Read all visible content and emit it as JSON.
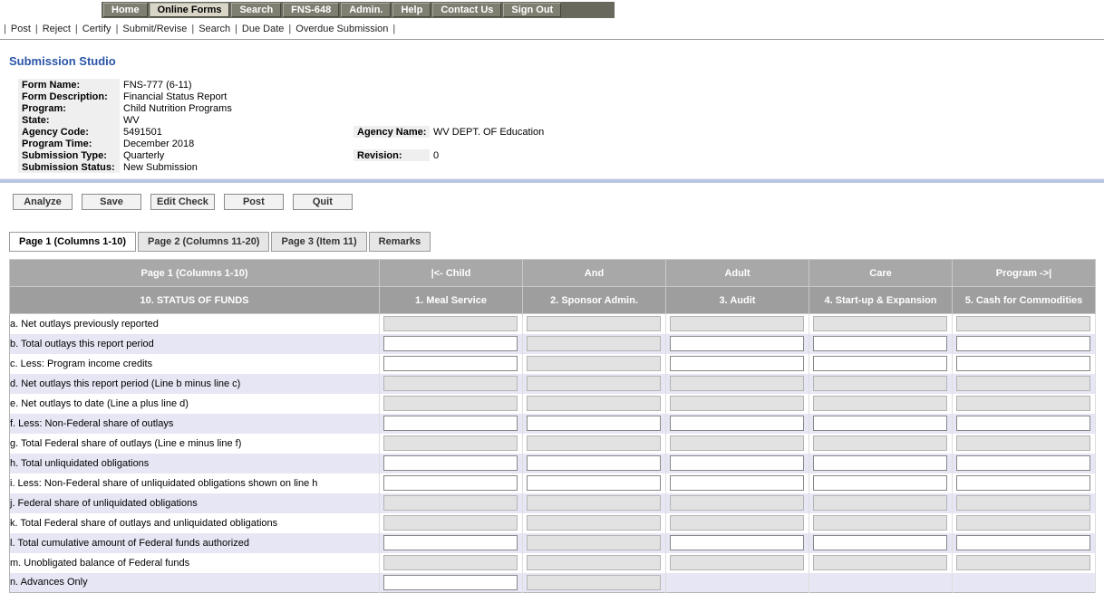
{
  "nav": {
    "items": [
      {
        "label": "Home",
        "active": false
      },
      {
        "label": "Online Forms",
        "active": true
      },
      {
        "label": "Search",
        "active": false
      },
      {
        "label": "FNS-648",
        "active": false
      },
      {
        "label": "Admin.",
        "active": false
      },
      {
        "label": "Help",
        "active": false
      },
      {
        "label": "Contact Us",
        "active": false
      },
      {
        "label": "Sign Out",
        "active": false
      }
    ]
  },
  "menu": {
    "items": [
      "Post",
      "Reject",
      "Certify",
      "Submit/Revise",
      "Search",
      "Due Date",
      "Overdue Submission"
    ]
  },
  "page_title": "Submission Studio",
  "info": {
    "rows": [
      {
        "label": "Form Name:",
        "value": "FNS-777 (6-11)"
      },
      {
        "label": "Form Description:",
        "value": "Financial Status Report"
      },
      {
        "label": "Program:",
        "value": "Child Nutrition Programs"
      },
      {
        "label": "State:",
        "value": "WV"
      },
      {
        "label": "Agency Code:",
        "value": "5491501",
        "label2": "Agency Name:",
        "value2": "WV DEPT. OF Education"
      },
      {
        "label": "Program Time:",
        "value": "December 2018"
      },
      {
        "label": "Submission Type:",
        "value": "Quarterly",
        "label2": "Revision:",
        "value2": "0"
      },
      {
        "label": "Submission Status:",
        "value": "New Submission"
      }
    ]
  },
  "actions": [
    "Analyze",
    "Save",
    "Edit Check",
    "Post",
    "Quit"
  ],
  "tabs": [
    {
      "label": "Page 1 (Columns 1-10)",
      "active": true
    },
    {
      "label": "Page 2 (Columns 11-20)",
      "active": false
    },
    {
      "label": "Page 3 (Item 11)",
      "active": false
    },
    {
      "label": "Remarks",
      "active": false
    }
  ],
  "grid": {
    "header_row1": [
      "Page 1 (Columns 1-10)",
      "|<- Child",
      "And",
      "Adult",
      "Care",
      "Program ->|"
    ],
    "header_row2": [
      "10. STATUS OF FUNDS",
      "1. Meal Service",
      "2. Sponsor Admin.",
      "3. Audit",
      "4. Start-up & Expansion",
      "5. Cash for Commodities"
    ],
    "rows": [
      {
        "label": "a. Net outlays previously reported",
        "cells": [
          {
            "type": "readonly",
            "value": ""
          },
          {
            "type": "readonly",
            "value": ""
          },
          {
            "type": "readonly",
            "value": ""
          },
          {
            "type": "readonly",
            "value": ""
          },
          {
            "type": "readonly",
            "value": ""
          }
        ]
      },
      {
        "label": "b. Total outlays this report period",
        "cells": [
          {
            "type": "input",
            "value": ""
          },
          {
            "type": "readonly",
            "value": ""
          },
          {
            "type": "input",
            "value": ""
          },
          {
            "type": "input",
            "value": ""
          },
          {
            "type": "input",
            "value": ""
          }
        ]
      },
      {
        "label": "c. Less: Program income credits",
        "cells": [
          {
            "type": "input",
            "value": ""
          },
          {
            "type": "readonly",
            "value": ""
          },
          {
            "type": "input",
            "value": ""
          },
          {
            "type": "input",
            "value": ""
          },
          {
            "type": "input",
            "value": ""
          }
        ]
      },
      {
        "label": "d. Net outlays this report period (Line b minus line c)",
        "cells": [
          {
            "type": "readonly",
            "value": ""
          },
          {
            "type": "readonly",
            "value": ""
          },
          {
            "type": "readonly",
            "value": ""
          },
          {
            "type": "readonly",
            "value": ""
          },
          {
            "type": "readonly",
            "value": ""
          }
        ]
      },
      {
        "label": "e. Net outlays to date (Line a plus line d)",
        "cells": [
          {
            "type": "readonly",
            "value": ""
          },
          {
            "type": "readonly",
            "value": ""
          },
          {
            "type": "readonly",
            "value": ""
          },
          {
            "type": "readonly",
            "value": ""
          },
          {
            "type": "readonly",
            "value": ""
          }
        ]
      },
      {
        "label": "f. Less: Non-Federal share of outlays",
        "cells": [
          {
            "type": "input",
            "value": ""
          },
          {
            "type": "input",
            "value": ""
          },
          {
            "type": "input",
            "value": ""
          },
          {
            "type": "input",
            "value": ""
          },
          {
            "type": "input",
            "value": ""
          }
        ]
      },
      {
        "label": "g. Total Federal share of outlays (Line e minus line f)",
        "cells": [
          {
            "type": "readonly",
            "value": ""
          },
          {
            "type": "readonly",
            "value": ""
          },
          {
            "type": "readonly",
            "value": ""
          },
          {
            "type": "readonly",
            "value": ""
          },
          {
            "type": "readonly",
            "value": ""
          }
        ]
      },
      {
        "label": "h. Total unliquidated obligations",
        "cells": [
          {
            "type": "input",
            "value": ""
          },
          {
            "type": "input",
            "value": ""
          },
          {
            "type": "input",
            "value": ""
          },
          {
            "type": "input",
            "value": ""
          },
          {
            "type": "input",
            "value": ""
          }
        ]
      },
      {
        "label": "i. Less: Non-Federal share of unliquidated obligations shown on line h",
        "cells": [
          {
            "type": "input",
            "value": ""
          },
          {
            "type": "input",
            "value": ""
          },
          {
            "type": "input",
            "value": ""
          },
          {
            "type": "input",
            "value": ""
          },
          {
            "type": "input",
            "value": ""
          }
        ]
      },
      {
        "label": "j. Federal share of unliquidated obligations",
        "cells": [
          {
            "type": "readonly",
            "value": ""
          },
          {
            "type": "readonly",
            "value": ""
          },
          {
            "type": "readonly",
            "value": ""
          },
          {
            "type": "readonly",
            "value": ""
          },
          {
            "type": "readonly",
            "value": ""
          }
        ]
      },
      {
        "label": "k. Total Federal share of outlays and unliquidated obligations",
        "cells": [
          {
            "type": "readonly",
            "value": ""
          },
          {
            "type": "readonly",
            "value": ""
          },
          {
            "type": "readonly",
            "value": ""
          },
          {
            "type": "readonly",
            "value": ""
          },
          {
            "type": "readonly",
            "value": ""
          }
        ]
      },
      {
        "label": "l. Total cumulative amount of Federal funds authorized",
        "cells": [
          {
            "type": "input",
            "value": ""
          },
          {
            "type": "readonly",
            "value": ""
          },
          {
            "type": "input",
            "value": ""
          },
          {
            "type": "input",
            "value": ""
          },
          {
            "type": "input",
            "value": ""
          }
        ]
      },
      {
        "label": "m. Unobligated balance of Federal funds",
        "cells": [
          {
            "type": "readonly",
            "value": ""
          },
          {
            "type": "readonly",
            "value": ""
          },
          {
            "type": "readonly",
            "value": ""
          },
          {
            "type": "readonly",
            "value": ""
          },
          {
            "type": "readonly",
            "value": ""
          }
        ]
      },
      {
        "label": "n. Advances Only",
        "cells": [
          {
            "type": "input",
            "value": ""
          },
          {
            "type": "readonly",
            "value": ""
          },
          {
            "type": "none"
          },
          {
            "type": "none"
          },
          {
            "type": "none"
          }
        ]
      }
    ]
  },
  "colors": {
    "title_blue": "#2b55a8",
    "nav_bar": "#68685c",
    "nav_button": "#7e7e71",
    "nav_active": "#d9d5c7",
    "grid_header_gray": "#a8a8a8",
    "grid_header_gray2": "#9e9e9e",
    "row_alt_lavender": "#e6e6f4",
    "separator_blue": "#b7c6e2",
    "readonly_gray": "#e2e2e2",
    "info_label_gray": "#efefef"
  }
}
